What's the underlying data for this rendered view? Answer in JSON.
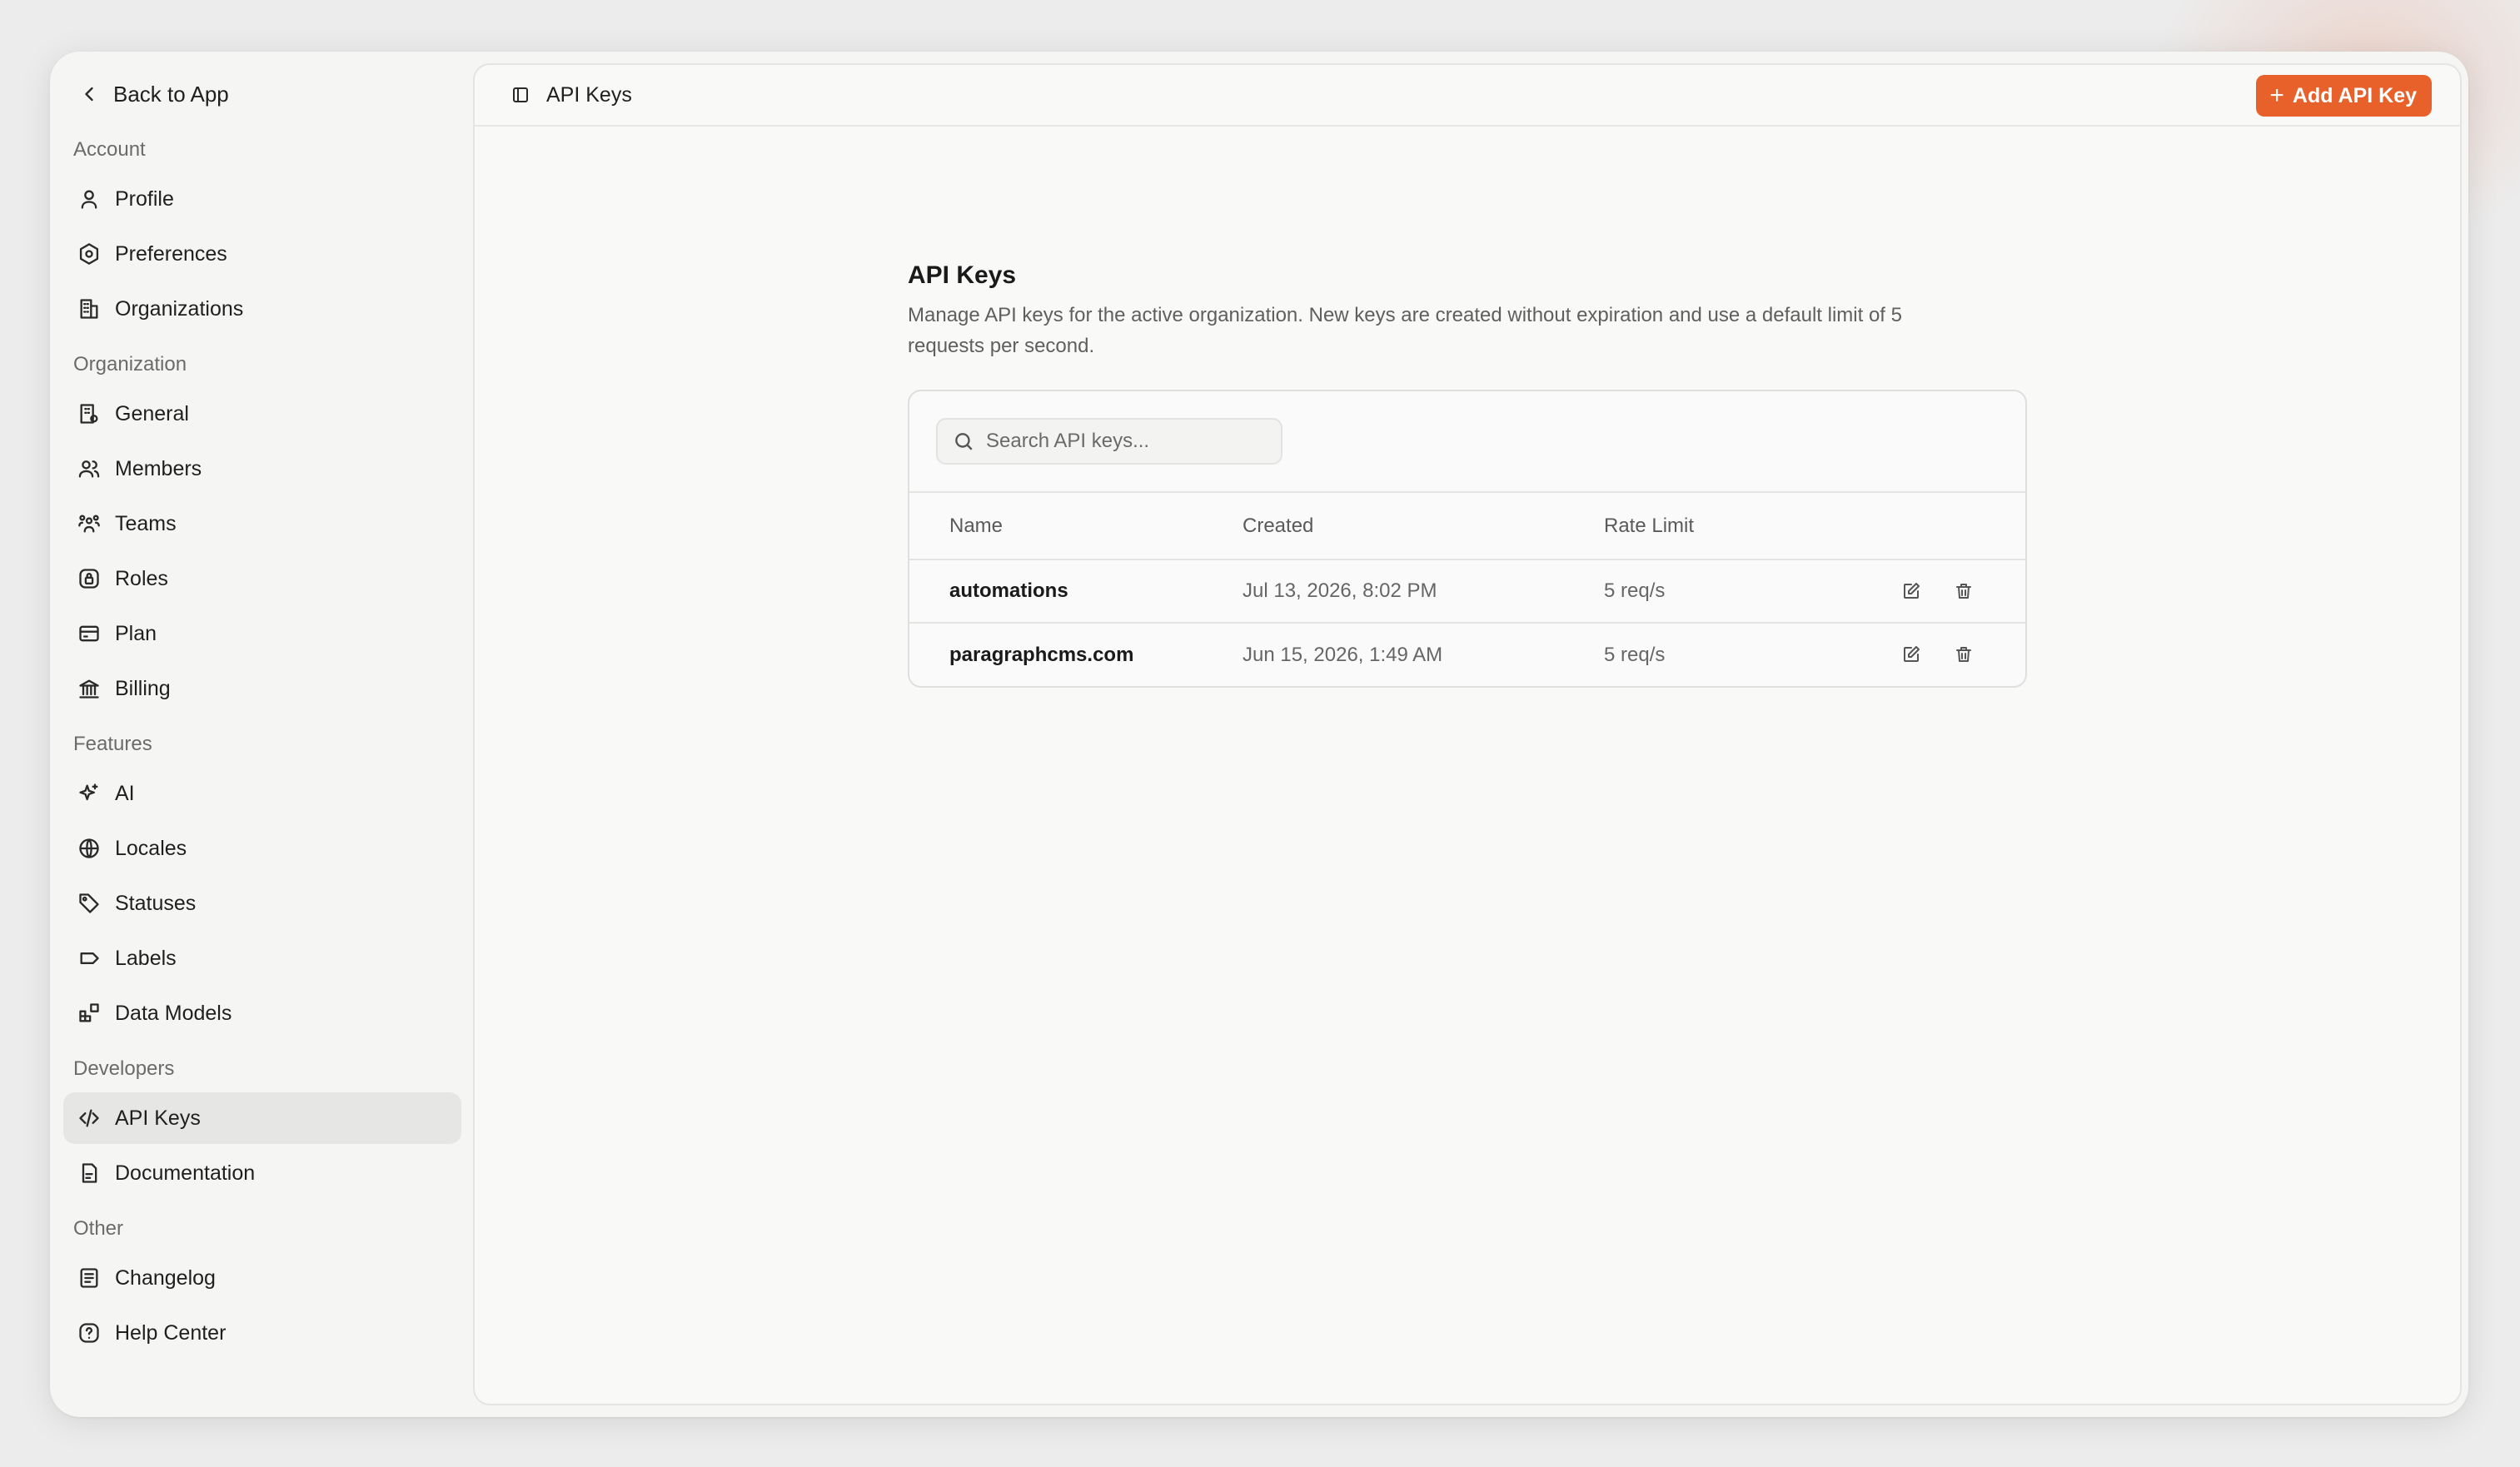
{
  "sidebar": {
    "back_label": "Back to App",
    "groups": [
      {
        "label": "Account",
        "items": [
          {
            "label": "Profile",
            "icon": "user-icon"
          },
          {
            "label": "Preferences",
            "icon": "settings-hex-icon"
          },
          {
            "label": "Organizations",
            "icon": "building-icon"
          }
        ]
      },
      {
        "label": "Organization",
        "items": [
          {
            "label": "General",
            "icon": "building-gear-icon"
          },
          {
            "label": "Members",
            "icon": "users-icon"
          },
          {
            "label": "Teams",
            "icon": "team-icon"
          },
          {
            "label": "Roles",
            "icon": "lock-square-icon"
          },
          {
            "label": "Plan",
            "icon": "credit-card-icon"
          },
          {
            "label": "Billing",
            "icon": "bank-icon"
          }
        ]
      },
      {
        "label": "Features",
        "items": [
          {
            "label": "AI",
            "icon": "sparkle-icon"
          },
          {
            "label": "Locales",
            "icon": "globe-icon"
          },
          {
            "label": "Statuses",
            "icon": "tag-icon"
          },
          {
            "label": "Labels",
            "icon": "label-icon"
          },
          {
            "label": "Data Models",
            "icon": "blocks-icon"
          }
        ]
      },
      {
        "label": "Developers",
        "items": [
          {
            "label": "API Keys",
            "icon": "code-icon",
            "active": true
          },
          {
            "label": "Documentation",
            "icon": "document-icon"
          }
        ]
      },
      {
        "label": "Other",
        "items": [
          {
            "label": "Changelog",
            "icon": "list-doc-icon"
          },
          {
            "label": "Help Center",
            "icon": "help-circle-icon"
          }
        ]
      }
    ]
  },
  "topbar": {
    "title": "API Keys",
    "add_button": "Add API Key",
    "accent": "#e8602a"
  },
  "main": {
    "title": "API Keys",
    "description": "Manage API keys for the active organization. New keys are created without expiration and use a default limit of 5 requests per second.",
    "search_placeholder": "Search API keys...",
    "columns": [
      "Name",
      "Created",
      "Rate Limit"
    ],
    "rows": [
      {
        "name": "automations",
        "created": "Jul 13, 2026, 8:02 PM",
        "rate": "5 req/s"
      },
      {
        "name": "paragraphcms.com",
        "created": "Jun 15, 2026, 1:49 AM",
        "rate": "5 req/s"
      }
    ]
  }
}
